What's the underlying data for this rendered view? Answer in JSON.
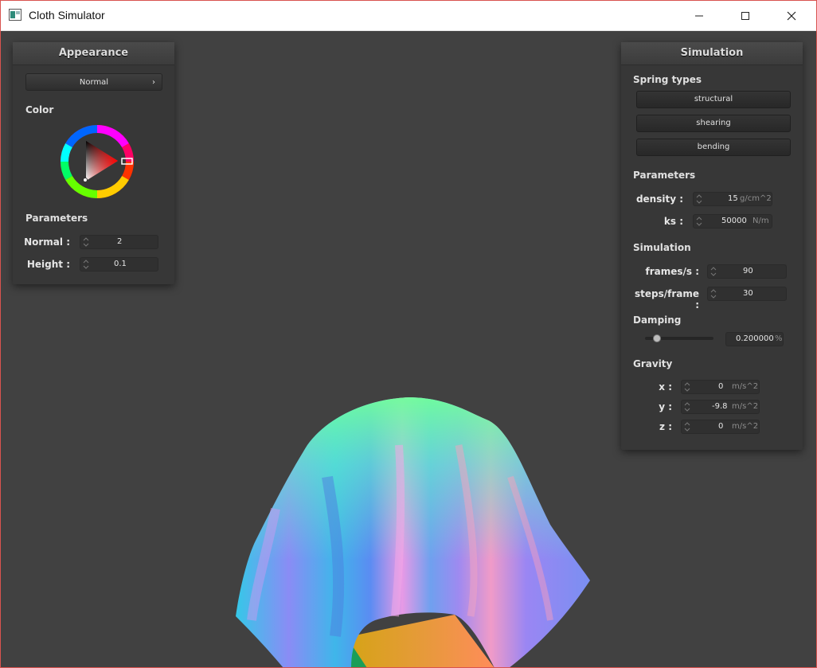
{
  "window": {
    "title": "Cloth Simulator",
    "icon": "app-window-icon"
  },
  "appearance": {
    "title": "Appearance",
    "shader": "Normal",
    "color_label": "Color",
    "color_value": "#ff0000",
    "parameters_label": "Parameters",
    "normal_label": "Normal :",
    "normal_value": "2",
    "height_label": "Height :",
    "height_value": "0.1"
  },
  "simulation": {
    "title": "Simulation",
    "spring_types_label": "Spring types",
    "structural": "structural",
    "shearing": "shearing",
    "bending": "bending",
    "parameters_label": "Parameters",
    "density_label": "density :",
    "density_value": "15",
    "density_unit": "g/cm^2",
    "ks_label": "ks :",
    "ks_value": "50000",
    "ks_unit": "N/m",
    "sim_label": "Simulation",
    "fps_label": "frames/s :",
    "fps_value": "90",
    "steps_label": "steps/frame :",
    "steps_value": "30",
    "damping_label": "Damping",
    "damping_value": "0.200000",
    "damping_unit": "%",
    "damping_level": 0.2,
    "gravity_label": "Gravity",
    "gx_label": "x :",
    "gx_value": "0",
    "gy_label": "y :",
    "gy_value": "-9.8",
    "gz_label": "z :",
    "gz_value": "0",
    "gravity_unit": "m/s^2"
  }
}
